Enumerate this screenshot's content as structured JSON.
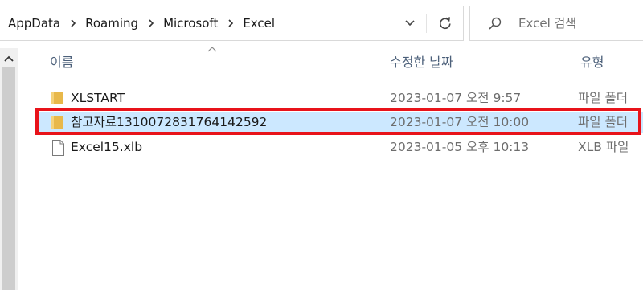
{
  "address_bar": {
    "path": [
      "AppData",
      "Roaming",
      "Microsoft",
      "Excel"
    ]
  },
  "search": {
    "placeholder": "Excel 검색"
  },
  "columns": {
    "name": "이름",
    "modified": "수정한 날짜",
    "type": "유형"
  },
  "files": [
    {
      "name": "XLSTART",
      "modified": "2023-01-07 오전 9:57",
      "type": "파일 폴더",
      "icon": "folder-icon",
      "selected": false
    },
    {
      "name": "참고자료1310072831764142592",
      "modified": "2023-01-07 오전 10:00",
      "type": "파일 폴더",
      "icon": "folder-icon",
      "selected": true
    },
    {
      "name": "Excel15.xlb",
      "modified": "2023-01-05 오후 10:13",
      "type": "XLB 파일",
      "icon": "file-icon",
      "selected": false
    }
  ],
  "colors": {
    "selection": "#cce8ff",
    "highlight_border": "#e8131a",
    "folder": "#e8b84a",
    "header_text": "#4c607a"
  }
}
